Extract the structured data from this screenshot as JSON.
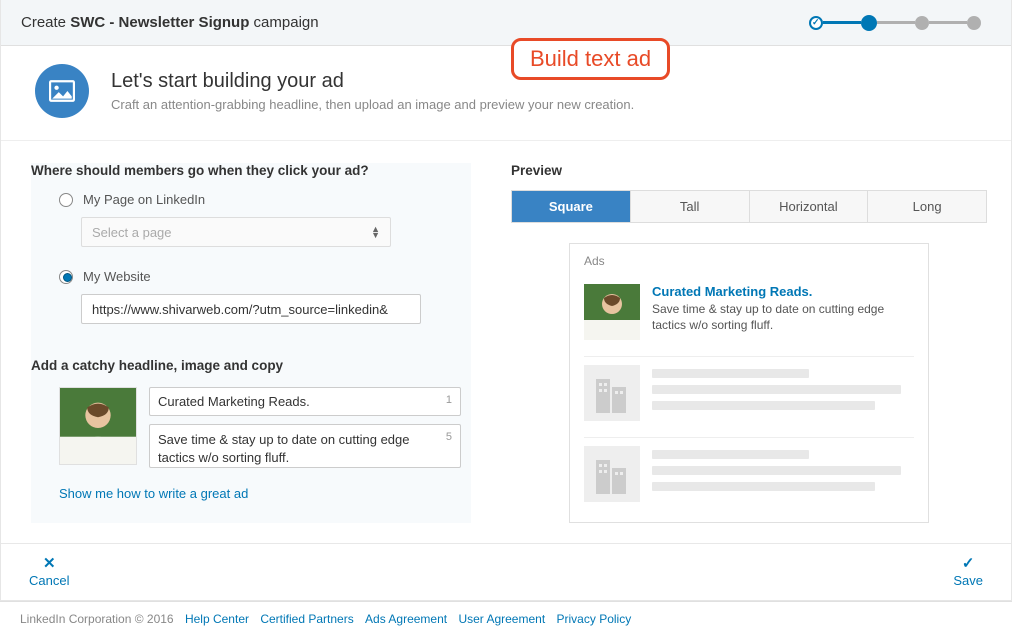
{
  "header": {
    "prefix": "Create ",
    "name": "SWC - Newsletter Signup",
    "suffix": " campaign"
  },
  "annotation": "Build text ad",
  "intro": {
    "title": "Let's start building your ad",
    "subtitle": "Craft an attention-grabbing headline, then upload an image and preview your new creation."
  },
  "form": {
    "destination_heading": "Where should members go when they click your ad?",
    "option_linkedin": "My Page on LinkedIn",
    "select_placeholder": "Select a page",
    "option_website": "My Website",
    "website_url": "https://www.shivarweb.com/?utm_source=linkedin&",
    "headline_heading": "Add a catchy headline, image and copy",
    "headline_value": "Curated Marketing Reads.",
    "headline_remaining": "1",
    "description_value": "Save time & stay up to date on cutting edge tactics w/o sorting fluff.",
    "description_remaining": "5",
    "tip_link": "Show me how to write a great ad"
  },
  "preview": {
    "heading": "Preview",
    "tabs": [
      "Square",
      "Tall",
      "Horizontal",
      "Long"
    ],
    "active_tab": "Square",
    "box_label": "Ads",
    "ad_headline": "Curated Marketing Reads.",
    "ad_description": "Save time & stay up to date on cutting edge tactics w/o sorting fluff."
  },
  "actions": {
    "cancel": "Cancel",
    "save": "Save"
  },
  "footer": {
    "copyright": "LinkedIn Corporation © 2016",
    "links": [
      "Help Center",
      "Certified Partners",
      "Ads Agreement",
      "User Agreement",
      "Privacy Policy"
    ]
  }
}
